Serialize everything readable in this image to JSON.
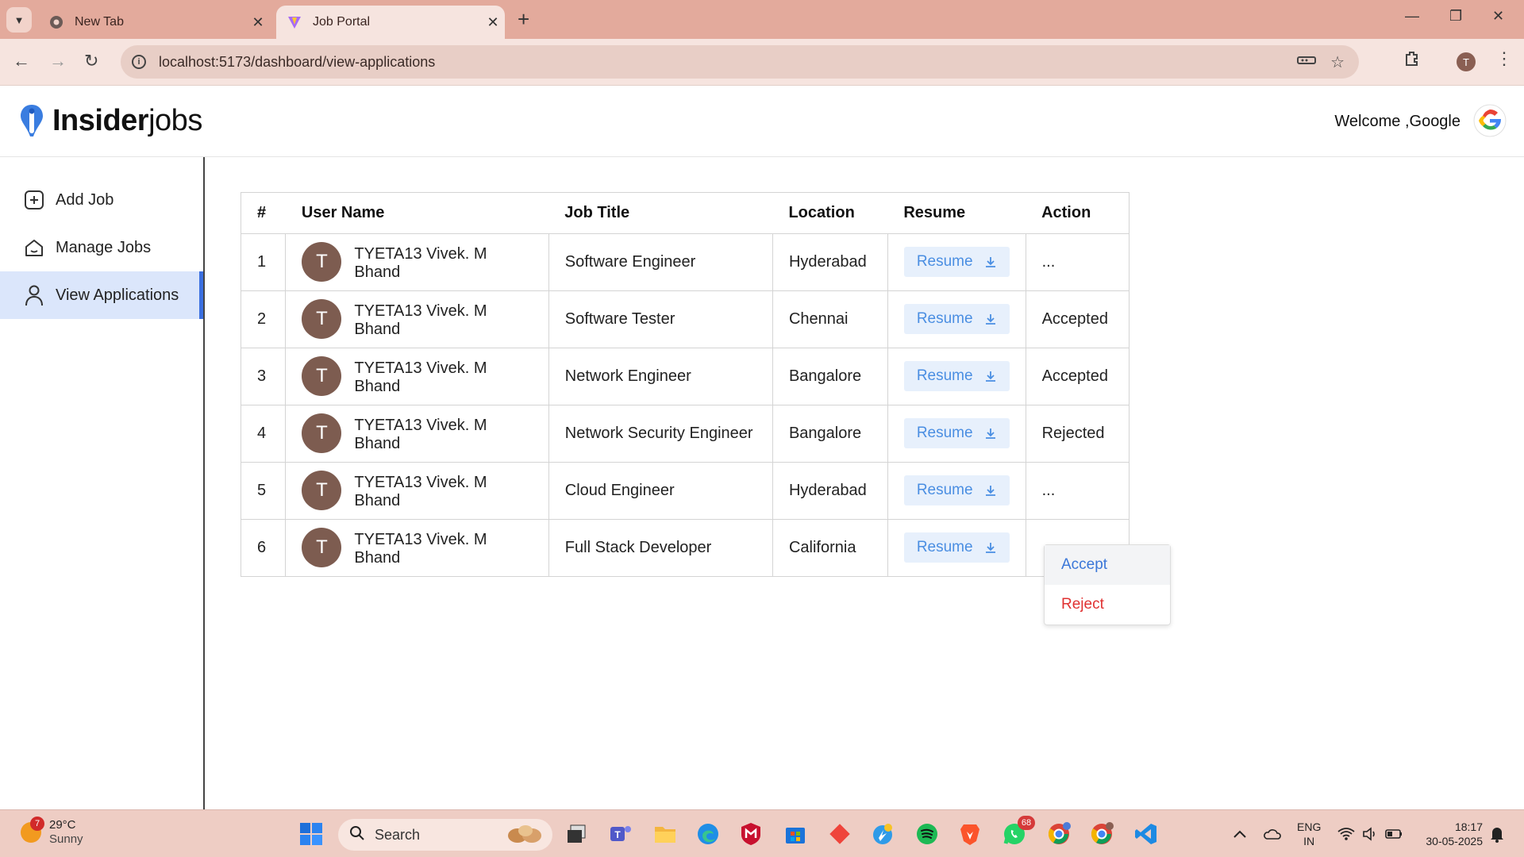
{
  "browser": {
    "tabs": [
      {
        "title": "New Tab"
      },
      {
        "title": "Job Portal"
      }
    ],
    "url": "localhost:5173/dashboard/view-applications",
    "profile_initial": "T"
  },
  "header": {
    "logo_bold": "Insider",
    "logo_light": "jobs",
    "welcome": "Welcome ,Google"
  },
  "sidebar": {
    "items": [
      {
        "label": "Add Job",
        "icon": "add-square-icon"
      },
      {
        "label": "Manage Jobs",
        "icon": "home-icon"
      },
      {
        "label": "View Applications",
        "icon": "person-icon",
        "active": true
      }
    ]
  },
  "table": {
    "headers": [
      "#",
      "User Name",
      "Job Title",
      "Location",
      "Resume",
      "Action"
    ],
    "rows": [
      {
        "num": "1",
        "initial": "T",
        "name": "TYETA13 Vivek. M Bhand",
        "job": "Software Engineer",
        "location": "Hyderabad",
        "resume": "Resume",
        "action": "..."
      },
      {
        "num": "2",
        "initial": "T",
        "name": "TYETA13 Vivek. M Bhand",
        "job": "Software Tester",
        "location": "Chennai",
        "resume": "Resume",
        "action": "Accepted"
      },
      {
        "num": "3",
        "initial": "T",
        "name": "TYETA13 Vivek. M Bhand",
        "job": "Network Engineer",
        "location": "Bangalore",
        "resume": "Resume",
        "action": "Accepted"
      },
      {
        "num": "4",
        "initial": "T",
        "name": "TYETA13 Vivek. M Bhand",
        "job": "Network Security Engineer",
        "location": "Bangalore",
        "resume": "Resume",
        "action": "Rejected"
      },
      {
        "num": "5",
        "initial": "T",
        "name": "TYETA13 Vivek. M Bhand",
        "job": "Cloud Engineer",
        "location": "Hyderabad",
        "resume": "Resume",
        "action": "..."
      },
      {
        "num": "6",
        "initial": "T",
        "name": "TYETA13 Vivek. M Bhand",
        "job": "Full Stack Developer",
        "location": "California",
        "resume": "Resume",
        "action": ""
      }
    ]
  },
  "action_menu": {
    "accept": "Accept",
    "reject": "Reject"
  },
  "taskbar": {
    "weather_temp": "29°C",
    "weather_cond": "Sunny",
    "weather_badge": "7",
    "search": "Search",
    "whatsapp_badge": "68",
    "lang_1": "ENG",
    "lang_2": "IN",
    "time": "18:17",
    "date": "30-05-2025"
  },
  "colors": {
    "accent": "#3b6fe0",
    "resume_text": "#4a8ee2",
    "reject": "#e03131",
    "avatar": "#7d5c50",
    "tabbar": "#e3aa9c"
  }
}
